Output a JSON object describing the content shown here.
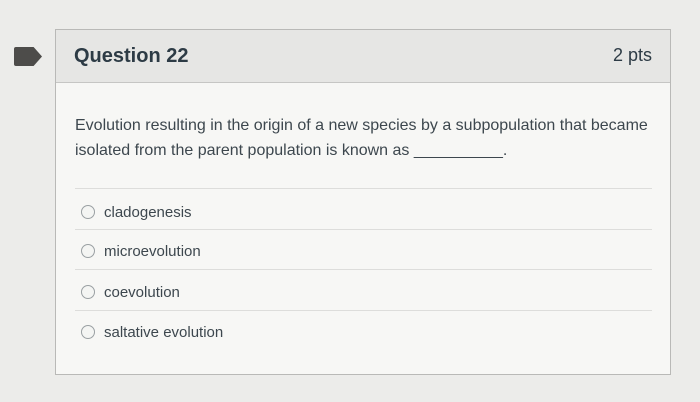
{
  "question": {
    "title": "Question 22",
    "points": "2 pts",
    "text": "Evolution resulting in the origin of a new species by a subpopulation that became isolated from the parent population is known as __________."
  },
  "answers": [
    {
      "label": "cladogenesis"
    },
    {
      "label": "microevolution"
    },
    {
      "label": "coevolution"
    },
    {
      "label": "saltative evolution"
    }
  ],
  "colors": {
    "background": "#ececea",
    "card": "#f7f7f5",
    "header": "#e6e6e4",
    "flag": "#4d4c4a",
    "text": "#2d3b45"
  },
  "icons": {
    "flag": "bookmark-flag-icon",
    "option": "radio-button"
  }
}
